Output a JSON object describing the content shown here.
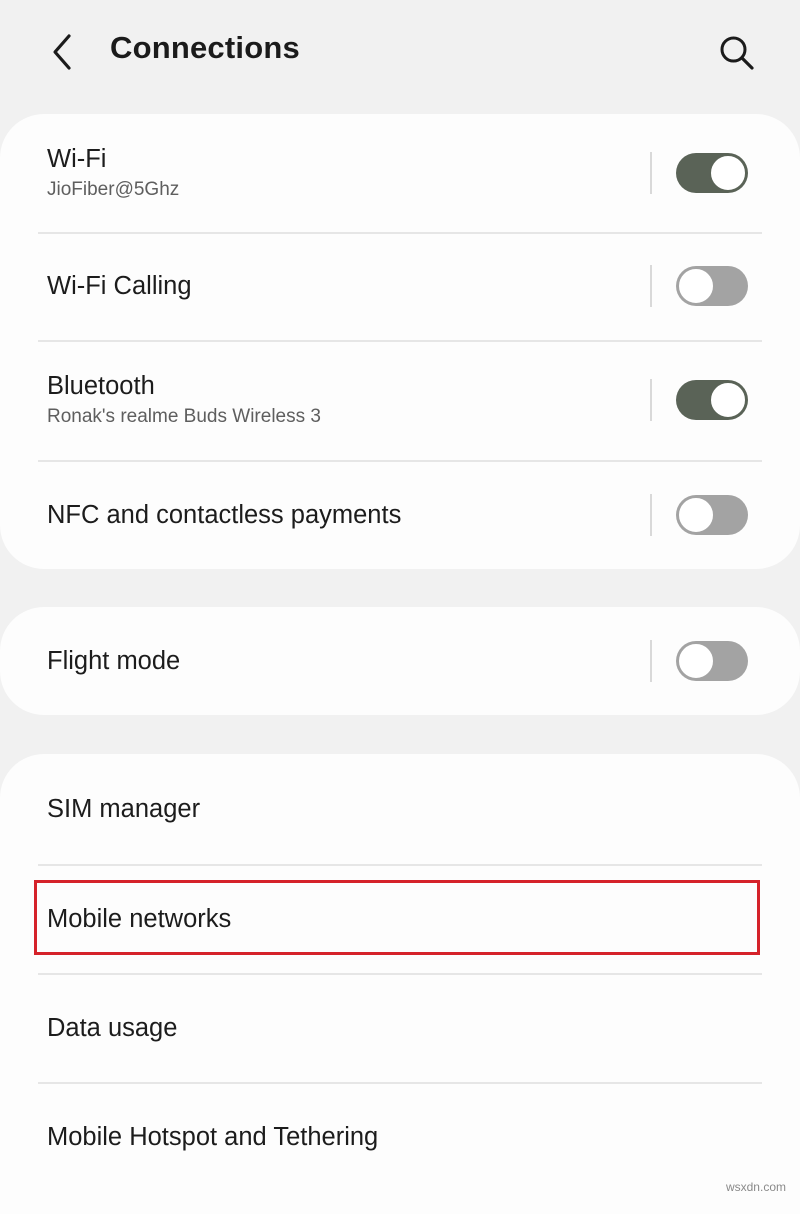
{
  "header": {
    "title": "Connections",
    "back_icon": "chevron-left-icon",
    "search_icon": "search-icon"
  },
  "groups": [
    {
      "items": [
        {
          "title": "Wi-Fi",
          "subtitle": "JioFiber@5Ghz",
          "toggle": true
        },
        {
          "title": "Wi-Fi Calling",
          "toggle": false
        },
        {
          "title": "Bluetooth",
          "subtitle": "Ronak's realme Buds Wireless 3",
          "toggle": true
        },
        {
          "title": "NFC and contactless payments",
          "toggle": false
        }
      ]
    },
    {
      "items": [
        {
          "title": "Flight mode",
          "toggle": false
        }
      ]
    },
    {
      "items": [
        {
          "title": "SIM manager"
        },
        {
          "title": "Mobile networks",
          "highlighted": true
        },
        {
          "title": "Data usage"
        },
        {
          "title": "Mobile Hotspot and Tethering"
        }
      ]
    }
  ],
  "colors": {
    "background": "#f1f1f1",
    "card": "#fdfdfd",
    "toggle_on": "#5a6357",
    "toggle_off": "#a3a3a3",
    "highlight": "#d5222a"
  },
  "watermark": "wsxdn.com"
}
